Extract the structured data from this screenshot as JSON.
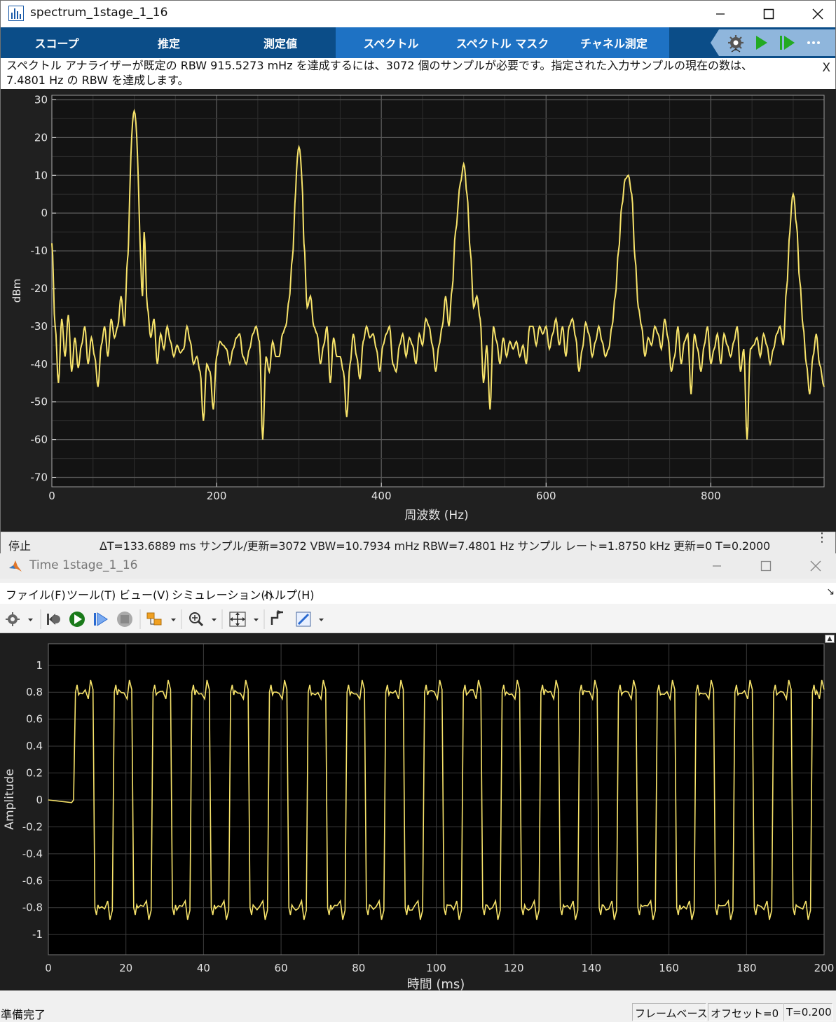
{
  "spectrum_window": {
    "title": "spectrum_1stage_1_16",
    "tabs": [
      {
        "label": "スコープ",
        "selected": false
      },
      {
        "label": "推定",
        "selected": false
      },
      {
        "label": "測定値",
        "selected": false
      },
      {
        "label": "スペクトル",
        "selected": true
      },
      {
        "label": "スペクトル マスク",
        "selected": true
      },
      {
        "label": "チャネル測定",
        "selected": true
      }
    ],
    "toolbar_icons": [
      "settings-icon",
      "play-icon",
      "step-forward-icon",
      "more-icon"
    ],
    "message": "スペクトル アナライザーが既定の RBW 915.5273 mHz を達成するには、3072 個のサンプルが必要です。指定された入力サンプルの現在の数は、7.4801 Hz の RBW を達成します。",
    "message_close": "X",
    "status_state": "停止",
    "status_info": "ΔT=133.6889 ms  サンプル/更新=3072  VBW=10.7934 mHz  RBW=7.4801 Hz  サンプル レート=1.8750 kHz  更新=0  T=0.2000",
    "status_more": "⋮"
  },
  "time_window": {
    "title": "Time 1stage_1_16",
    "menu": [
      "ファイル(F)",
      "ツール(T)",
      "ビュー(V)",
      "シミュレーション(I)",
      "ヘルプ(H)"
    ],
    "toolbar_icons": [
      "settings-icon",
      "run-back-icon",
      "run-icon",
      "step-icon",
      "stop-icon",
      "signal-select-icon",
      "zoom-icon",
      "fit-icon",
      "triggers-icon",
      "measurements-icon"
    ],
    "status_ready": "準備完了",
    "status_cells": [
      "フレームベース",
      "オフセット=0",
      "T=0.200"
    ]
  },
  "chart_data": [
    {
      "type": "line",
      "xlabel": "周波数 (Hz)",
      "ylabel": "dBm",
      "xlim": [
        0,
        937.5
      ],
      "ylim": [
        -72.5,
        31.2
      ],
      "xticks": [
        0,
        200,
        400,
        600,
        800
      ],
      "yticks": [
        30,
        20,
        10,
        0,
        -10,
        -20,
        -30,
        -40,
        -50,
        -60,
        -70
      ],
      "grid": true,
      "line_color": "#f7e36a",
      "peaks": [
        {
          "x": 100,
          "y": 27
        },
        {
          "x": 300,
          "y": 17.5
        },
        {
          "x": 500,
          "y": 13
        },
        {
          "x": 700,
          "y": 10
        },
        {
          "x": 900,
          "y": 5
        }
      ],
      "points": [
        [
          0,
          -8
        ],
        [
          4,
          -30
        ],
        [
          8,
          -45
        ],
        [
          12,
          -28
        ],
        [
          16,
          -38
        ],
        [
          20,
          -27
        ],
        [
          24,
          -42
        ],
        [
          28,
          -33
        ],
        [
          32,
          -41
        ],
        [
          36,
          -35
        ],
        [
          40,
          -30
        ],
        [
          44,
          -40
        ],
        [
          48,
          -33
        ],
        [
          52,
          -38
        ],
        [
          56,
          -46
        ],
        [
          60,
          -35
        ],
        [
          64,
          -30
        ],
        [
          68,
          -38
        ],
        [
          72,
          -28
        ],
        [
          76,
          -33
        ],
        [
          80,
          -30
        ],
        [
          84,
          -22
        ],
        [
          88,
          -30
        ],
        [
          92,
          -12
        ],
        [
          94,
          -5
        ],
        [
          96,
          8
        ],
        [
          100,
          27
        ],
        [
          104,
          10
        ],
        [
          106,
          -5
        ],
        [
          110,
          -22
        ],
        [
          112,
          -5
        ],
        [
          116,
          -25
        ],
        [
          120,
          -33
        ],
        [
          124,
          -28
        ],
        [
          128,
          -40
        ],
        [
          132,
          -32
        ],
        [
          136,
          -36
        ],
        [
          140,
          -30
        ],
        [
          144,
          -34
        ],
        [
          148,
          -38
        ],
        [
          152,
          -35
        ],
        [
          156,
          -37
        ],
        [
          160,
          -36
        ],
        [
          164,
          -30
        ],
        [
          168,
          -34
        ],
        [
          172,
          -40
        ],
        [
          176,
          -38
        ],
        [
          180,
          -42
        ],
        [
          184,
          -55
        ],
        [
          188,
          -40
        ],
        [
          192,
          -42
        ],
        [
          196,
          -52
        ],
        [
          200,
          -38
        ],
        [
          204,
          -34
        ],
        [
          208,
          -35
        ],
        [
          212,
          -36
        ],
        [
          216,
          -40
        ],
        [
          220,
          -36
        ],
        [
          224,
          -33
        ],
        [
          228,
          -32
        ],
        [
          232,
          -38
        ],
        [
          236,
          -40
        ],
        [
          240,
          -36
        ],
        [
          244,
          -32
        ],
        [
          248,
          -30
        ],
        [
          252,
          -34
        ],
        [
          256,
          -60
        ],
        [
          260,
          -38
        ],
        [
          264,
          -42
        ],
        [
          268,
          -34
        ],
        [
          272,
          -38
        ],
        [
          276,
          -38
        ],
        [
          280,
          -32
        ],
        [
          284,
          -30
        ],
        [
          288,
          -23
        ],
        [
          292,
          -12
        ],
        [
          296,
          5
        ],
        [
          300,
          17.5
        ],
        [
          304,
          7
        ],
        [
          306,
          -8
        ],
        [
          310,
          -25
        ],
        [
          314,
          -22
        ],
        [
          318,
          -30
        ],
        [
          322,
          -32
        ],
        [
          326,
          -40
        ],
        [
          330,
          -35
        ],
        [
          334,
          -30
        ],
        [
          338,
          -45
        ],
        [
          342,
          -33
        ],
        [
          346,
          -38
        ],
        [
          350,
          -38
        ],
        [
          354,
          -42
        ],
        [
          358,
          -54
        ],
        [
          362,
          -40
        ],
        [
          366,
          -32
        ],
        [
          370,
          -38
        ],
        [
          374,
          -44
        ],
        [
          378,
          -34
        ],
        [
          382,
          -30
        ],
        [
          386,
          -33
        ],
        [
          390,
          -32
        ],
        [
          394,
          -36
        ],
        [
          398,
          -42
        ],
        [
          402,
          -35
        ],
        [
          406,
          -32
        ],
        [
          410,
          -30
        ],
        [
          414,
          -40
        ],
        [
          418,
          -42
        ],
        [
          422,
          -35
        ],
        [
          426,
          -32
        ],
        [
          430,
          -38
        ],
        [
          434,
          -33
        ],
        [
          438,
          -35
        ],
        [
          442,
          -40
        ],
        [
          446,
          -32
        ],
        [
          450,
          -35
        ],
        [
          454,
          -28
        ],
        [
          458,
          -30
        ],
        [
          462,
          -35
        ],
        [
          466,
          -42
        ],
        [
          470,
          -35
        ],
        [
          474,
          -30
        ],
        [
          478,
          -22
        ],
        [
          482,
          -30
        ],
        [
          486,
          -20
        ],
        [
          490,
          -5
        ],
        [
          496,
          8
        ],
        [
          500,
          13
        ],
        [
          504,
          5
        ],
        [
          508,
          -10
        ],
        [
          512,
          -25
        ],
        [
          516,
          -22
        ],
        [
          520,
          -28
        ],
        [
          524,
          -45
        ],
        [
          528,
          -35
        ],
        [
          532,
          -52
        ],
        [
          536,
          -30
        ],
        [
          540,
          -34
        ],
        [
          544,
          -40
        ],
        [
          548,
          -33
        ],
        [
          552,
          -38
        ],
        [
          556,
          -34
        ],
        [
          560,
          -36
        ],
        [
          564,
          -34
        ],
        [
          568,
          -38
        ],
        [
          572,
          -35
        ],
        [
          576,
          -40
        ],
        [
          580,
          -30
        ],
        [
          584,
          -30
        ],
        [
          588,
          -35
        ],
        [
          592,
          -30
        ],
        [
          596,
          -32
        ],
        [
          600,
          -30
        ],
        [
          604,
          -36
        ],
        [
          608,
          -32
        ],
        [
          612,
          -28
        ],
        [
          616,
          -35
        ],
        [
          620,
          -30
        ],
        [
          624,
          -38
        ],
        [
          628,
          -30
        ],
        [
          632,
          -28
        ],
        [
          636,
          -33
        ],
        [
          640,
          -42
        ],
        [
          644,
          -36
        ],
        [
          648,
          -29
        ],
        [
          652,
          -32
        ],
        [
          656,
          -38
        ],
        [
          660,
          -34
        ],
        [
          664,
          -30
        ],
        [
          668,
          -34
        ],
        [
          672,
          -38
        ],
        [
          676,
          -36
        ],
        [
          680,
          -30
        ],
        [
          684,
          -22
        ],
        [
          688,
          -10
        ],
        [
          692,
          2
        ],
        [
          696,
          9
        ],
        [
          700,
          10
        ],
        [
          704,
          5
        ],
        [
          708,
          -12
        ],
        [
          712,
          -25
        ],
        [
          716,
          -30
        ],
        [
          720,
          -38
        ],
        [
          724,
          -33
        ],
        [
          728,
          -35
        ],
        [
          732,
          -30
        ],
        [
          736,
          -32
        ],
        [
          740,
          -36
        ],
        [
          744,
          -28
        ],
        [
          748,
          -33
        ],
        [
          752,
          -42
        ],
        [
          756,
          -38
        ],
        [
          760,
          -30
        ],
        [
          764,
          -40
        ],
        [
          768,
          -34
        ],
        [
          772,
          -32
        ],
        [
          776,
          -48
        ],
        [
          780,
          -32
        ],
        [
          784,
          -36
        ],
        [
          788,
          -42
        ],
        [
          792,
          -35
        ],
        [
          796,
          -30
        ],
        [
          800,
          -40
        ],
        [
          804,
          -36
        ],
        [
          808,
          -32
        ],
        [
          812,
          -40
        ],
        [
          816,
          -32
        ],
        [
          820,
          -35
        ],
        [
          824,
          -38
        ],
        [
          828,
          -34
        ],
        [
          832,
          -30
        ],
        [
          836,
          -42
        ],
        [
          840,
          -36
        ],
        [
          844,
          -60
        ],
        [
          848,
          -36
        ],
        [
          852,
          -35
        ],
        [
          856,
          -33
        ],
        [
          860,
          -38
        ],
        [
          864,
          -32
        ],
        [
          868,
          -35
        ],
        [
          872,
          -40
        ],
        [
          876,
          -36
        ],
        [
          880,
          -32
        ],
        [
          884,
          -30
        ],
        [
          888,
          -35
        ],
        [
          892,
          -20
        ],
        [
          896,
          -5
        ],
        [
          900,
          5
        ],
        [
          904,
          -3
        ],
        [
          908,
          -18
        ],
        [
          912,
          -30
        ],
        [
          916,
          -40
        ],
        [
          920,
          -48
        ],
        [
          924,
          -38
        ],
        [
          928,
          -32
        ],
        [
          932,
          -40
        ],
        [
          937.5,
          -46
        ]
      ]
    },
    {
      "type": "line",
      "xlabel": "時間 (ms)",
      "ylabel": "Amplitude",
      "xlim": [
        0,
        200
      ],
      "ylim": [
        -1.15,
        1.16
      ],
      "xticks": [
        0,
        20,
        40,
        60,
        80,
        100,
        120,
        140,
        160,
        180,
        200
      ],
      "yticks": [
        1,
        0.8,
        0.6,
        0.4,
        0.2,
        0,
        -0.2,
        -0.4,
        -0.6,
        -0.8,
        -1
      ],
      "grid": true,
      "line_color": "#f7e36a",
      "initial_level": 0,
      "initial_until_ms": 6,
      "high_level": 0.8,
      "low_level": -0.8,
      "transitions_ms": [
        6.5,
        11.5,
        16.5,
        21.5,
        26.5,
        31.5,
        36.5,
        41.5,
        46.5,
        51.5,
        56.5,
        61.5,
        66.5,
        71.5,
        76.5,
        81.5,
        86.5,
        91.5,
        96.5,
        101.5,
        106.5,
        111.5,
        116.5,
        121.5,
        126.5,
        131.5,
        136.5,
        141.5,
        146.5,
        151.5,
        156.5,
        161.5,
        166.5,
        171.5,
        176.5,
        181.5,
        186.5,
        191.5,
        196.5
      ],
      "overshoot": 0.09
    }
  ]
}
